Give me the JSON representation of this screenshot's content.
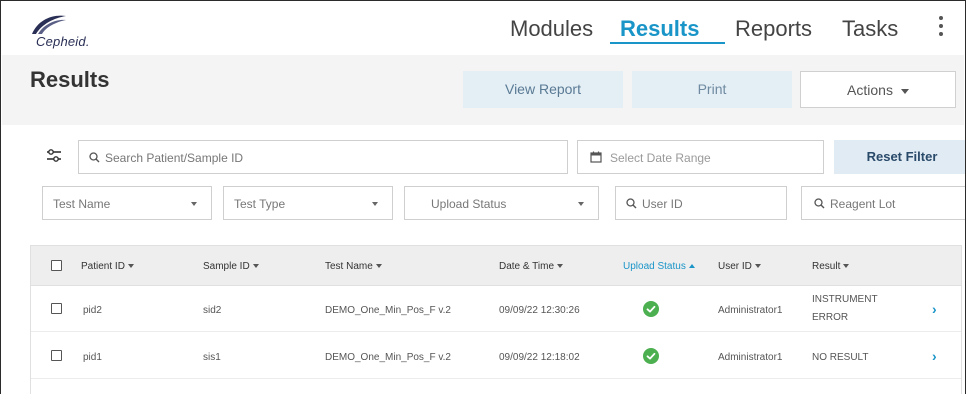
{
  "header": {
    "logo_text": "Cepheid.",
    "nav": [
      {
        "label": "Modules"
      },
      {
        "label": "Results"
      },
      {
        "label": "Reports"
      },
      {
        "label": "Tasks"
      }
    ]
  },
  "toolbar": {
    "title": "Results",
    "view_report": "View Report",
    "print": "Print",
    "actions": "Actions"
  },
  "filters": {
    "search_placeholder": "Search Patient/Sample ID",
    "date_placeholder": "Select Date Range",
    "reset_label": "Reset Filter",
    "test_name": "Test Name",
    "test_type": "Test Type",
    "upload_status": "Upload Status",
    "user_id": "User ID",
    "reagent_lot": "Reagent Lot"
  },
  "table": {
    "headers": {
      "patient_id": "Patient ID",
      "sample_id": "Sample ID",
      "test_name": "Test Name",
      "date_time": "Date & Time",
      "upload_status": "Upload Status",
      "user_id": "User ID",
      "result": "Result"
    },
    "rows": [
      {
        "patient_id": "pid2",
        "sample_id": "sid2",
        "test_name": "DEMO_One_Min_Pos_F v.2",
        "date_time": "09/09/22 12:30:26",
        "user_id": "Administrator1",
        "result_line1": "INSTRUMENT",
        "result_line2": "ERROR"
      },
      {
        "patient_id": "pid1",
        "sample_id": "sis1",
        "test_name": "DEMO_One_Min_Pos_F v.2",
        "date_time": "09/09/22 12:18:02",
        "user_id": "Administrator1",
        "result_line1": "NO RESULT"
      }
    ]
  },
  "colors": {
    "accent": "#1a95c8",
    "success": "#4caf50"
  }
}
